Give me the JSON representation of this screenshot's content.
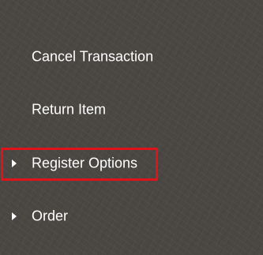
{
  "menu": {
    "items": [
      {
        "label": "Cancel Transaction",
        "expandable": false
      },
      {
        "label": "Return Item",
        "expandable": false
      },
      {
        "label": "Register Options",
        "expandable": true,
        "icon": "caret-right-icon",
        "highlighted": true
      },
      {
        "label": "Order",
        "expandable": true,
        "icon": "caret-right-icon"
      }
    ]
  },
  "colors": {
    "background": "#4a4642",
    "text": "#ffffff",
    "highlight": "#e0121a"
  }
}
